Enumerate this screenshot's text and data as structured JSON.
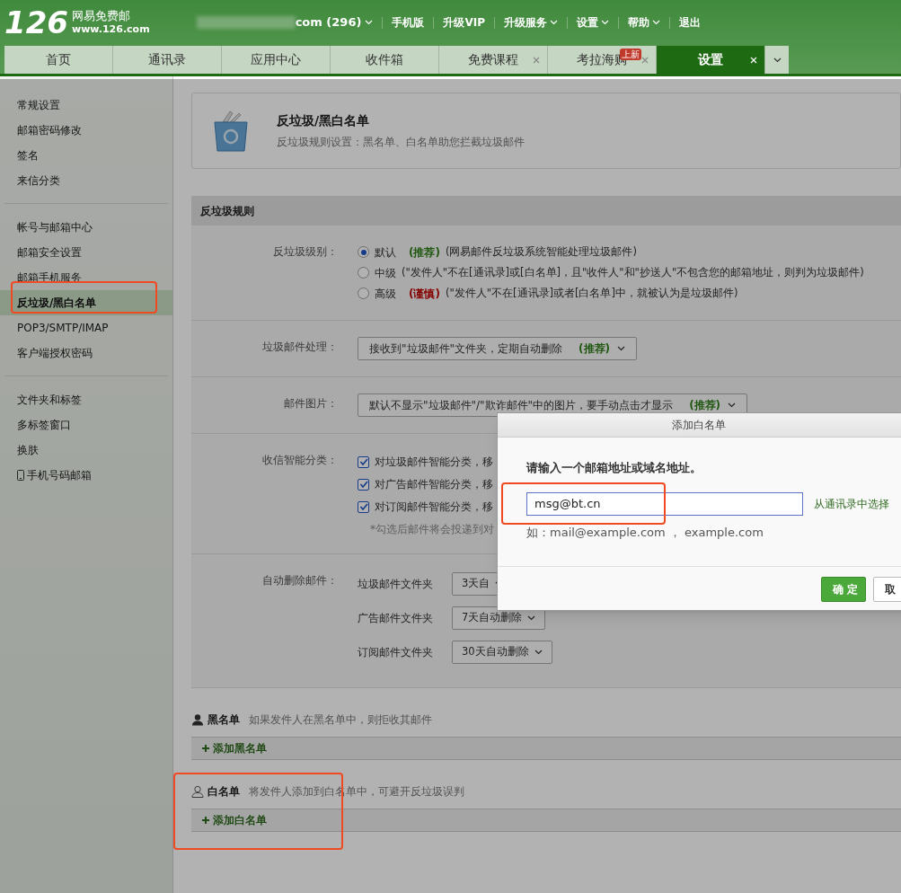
{
  "header": {
    "logo": "126",
    "brand": "网易免费邮",
    "url": "www.126.com",
    "account": "com (296)",
    "links": [
      {
        "label": "手机版",
        "dropdown": false
      },
      {
        "label": "升级VIP",
        "dropdown": false
      },
      {
        "label": "升级服务",
        "dropdown": true
      },
      {
        "label": "设置",
        "dropdown": true
      },
      {
        "label": "帮助",
        "dropdown": true
      },
      {
        "label": "退出",
        "dropdown": false
      }
    ]
  },
  "tabs": [
    {
      "label": "首页",
      "selected": false,
      "closable": false
    },
    {
      "label": "通讯录",
      "selected": false,
      "closable": false
    },
    {
      "label": "应用中心",
      "selected": false,
      "closable": false
    },
    {
      "label": "收件箱",
      "selected": false,
      "closable": false
    },
    {
      "label": "免费课程",
      "selected": false,
      "closable": true
    },
    {
      "label": "考拉海购",
      "selected": false,
      "closable": true,
      "badge": "上新"
    },
    {
      "label": "设置",
      "selected": true,
      "closable": true
    }
  ],
  "sidebar": {
    "groups": [
      [
        {
          "label": "常规设置",
          "selected": false
        },
        {
          "label": "邮箱密码修改",
          "selected": false
        },
        {
          "label": "签名",
          "selected": false
        },
        {
          "label": "来信分类",
          "selected": false
        }
      ],
      [
        {
          "label": "帐号与邮箱中心",
          "selected": false
        },
        {
          "label": "邮箱安全设置",
          "selected": false
        },
        {
          "label": "邮箱手机服务",
          "selected": false
        },
        {
          "label": "反垃圾/黑白名单",
          "selected": true
        },
        {
          "label": "POP3/SMTP/IMAP",
          "selected": false
        },
        {
          "label": "客户端授权密码",
          "selected": false
        }
      ],
      [
        {
          "label": "文件夹和标签",
          "selected": false
        },
        {
          "label": "多标签窗口",
          "selected": false
        },
        {
          "label": "换肤",
          "selected": false
        },
        {
          "label": "手机号码邮箱",
          "selected": false,
          "kind": "phone"
        }
      ]
    ]
  },
  "page_header": {
    "title": "反垃圾/黑白名单",
    "subtitle": "反垃圾规则设置：黑名单、白名单助您拦截垃圾邮件"
  },
  "rules": {
    "title": "反垃圾规则",
    "rows": [
      {
        "kind": "radio",
        "label": "反垃圾级别：",
        "options": [
          {
            "label": "默认",
            "tag": {
              "text": "(推荐)",
              "kind": "recommend"
            },
            "text": "(网易邮件反垃圾系统智能处理垃圾邮件)",
            "selected": true
          },
          {
            "label": "中级",
            "text": "(\"发件人\"不在[通讯录]或[白名单]，且\"收件人\"和\"抄送人\"不包含您的邮箱地址，则判为垃圾邮件)",
            "selected": false
          },
          {
            "label": "高级",
            "tag": {
              "text": "(谨慎)",
              "kind": "caution"
            },
            "text": "(\"发件人\"不在[通讯录]或者[白名单]中，就被认为是垃圾邮件)",
            "selected": false
          }
        ]
      },
      {
        "kind": "select",
        "label": "垃圾邮件处理：",
        "value": "接收到\"垃圾邮件\"文件夹，定期自动删除",
        "tag": "(推荐)"
      },
      {
        "kind": "select",
        "label": "邮件图片：",
        "value": "默认不显示\"垃圾邮件\"/\"欺诈邮件\"中的图片，要手动点击才显示",
        "tag": "(推荐)"
      },
      {
        "kind": "checks",
        "label": "收信智能分类：",
        "items": [
          {
            "label": "对垃圾邮件智能分类，移",
            "checked": true
          },
          {
            "label": "对广告邮件智能分类，移",
            "checked": true
          },
          {
            "label": "对订阅邮件智能分类，移",
            "checked": true
          }
        ],
        "note": "*勾选后邮件将会投递到对"
      },
      {
        "kind": "folders",
        "label": "自动删除邮件：",
        "items": [
          {
            "label": "垃圾邮件文件夹",
            "value": "3天自"
          },
          {
            "label": "广告邮件文件夹",
            "value": "7天自动删除"
          },
          {
            "label": "订阅邮件文件夹",
            "value": "30天自动删除"
          }
        ]
      }
    ]
  },
  "lists": [
    {
      "kind": "black",
      "title": "黑名单",
      "description": "如果发件人在黑名单中，则拒收其邮件",
      "add": "添加黑名单"
    },
    {
      "kind": "white",
      "title": "白名单",
      "description": "将发件人添加到白名单中，可避开反垃圾误判",
      "add": "添加白名单"
    }
  ],
  "dialog": {
    "title": "添加白名单",
    "prompt": "请输入一个邮箱地址或域名地址。",
    "value": "msg@bt.cn",
    "link": "从通讯录中选择",
    "example": "如：mail@example.com ， example.com",
    "buttons": [
      {
        "label": "确 定",
        "kind": "primary"
      },
      {
        "label": "取",
        "kind": "secondary"
      }
    ]
  }
}
